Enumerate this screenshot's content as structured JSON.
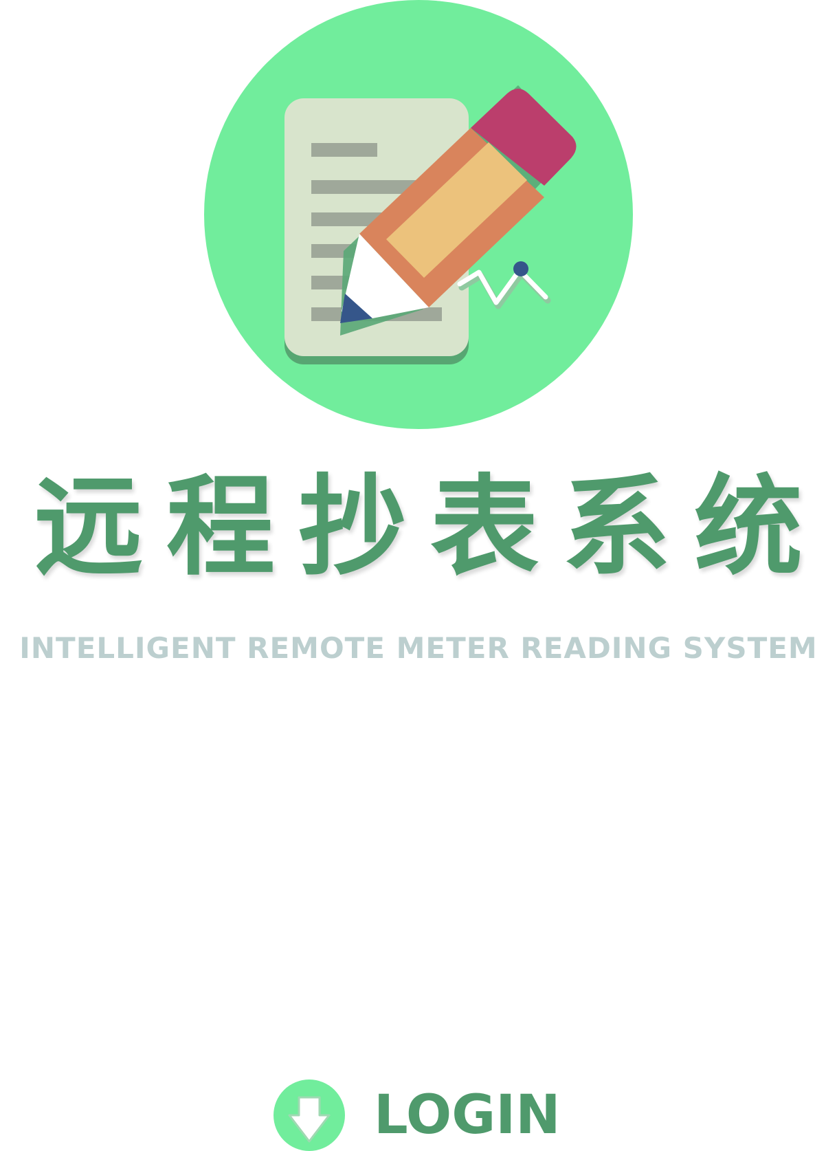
{
  "logo": {
    "icon": "document-pencil-icon",
    "circle_color": "#71ed9c"
  },
  "title": {
    "text": "远程抄表系统",
    "color": "#4f9a6c"
  },
  "subtitle": {
    "text": "INTELLIGENT REMOTE METER READING SYSTEM",
    "color": "#bccfcf"
  },
  "login": {
    "label": "LOGIN",
    "icon": "arrow-down-icon",
    "color": "#4f9a6c",
    "icon_background": "#71ed9c"
  }
}
